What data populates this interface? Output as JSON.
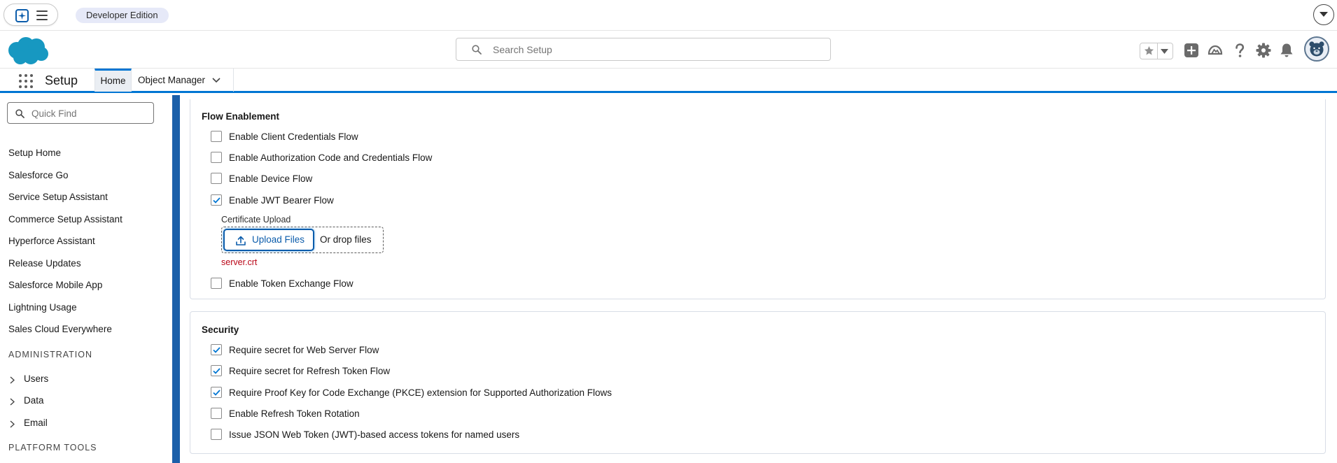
{
  "topbar": {
    "edition_badge": "Developer Edition",
    "icons": [
      "agentforce-icon",
      "menu-icon",
      "chevron-down-icon"
    ]
  },
  "header": {
    "search_placeholder": "Search Setup",
    "icons": [
      "salesforce-cloud-logo",
      "search-icon",
      "favorite-star-icon",
      "favorites-dropdown-icon",
      "global-actions-add-icon",
      "trailhead-icon",
      "help-icon",
      "setup-gear-icon",
      "notifications-bell-icon",
      "user-avatar"
    ]
  },
  "context_bar": {
    "app_title": "Setup",
    "tabs": [
      {
        "label": "Home",
        "active": true
      },
      {
        "label": "Object Manager",
        "active": false
      }
    ]
  },
  "sidebar": {
    "quick_find_placeholder": "Quick Find",
    "links": [
      "Setup Home",
      "Salesforce Go",
      "Service Setup Assistant",
      "Commerce Setup Assistant",
      "Hyperforce Assistant",
      "Release Updates",
      "Salesforce Mobile App",
      "Lightning Usage",
      "Sales Cloud Everywhere"
    ],
    "administration_heading": "ADMINISTRATION",
    "administration_items": [
      "Users",
      "Data",
      "Email"
    ],
    "platform_tools_heading": "PLATFORM TOOLS"
  },
  "flow_enablement": {
    "title": "Flow Enablement",
    "options": [
      {
        "label": "Enable Client Credentials Flow",
        "checked": false
      },
      {
        "label": "Enable Authorization Code and Credentials Flow",
        "checked": false
      },
      {
        "label": "Enable Device Flow",
        "checked": false
      },
      {
        "label": "Enable JWT Bearer Flow",
        "checked": true
      },
      {
        "label": "Enable Token Exchange Flow",
        "checked": false
      }
    ],
    "certificate_upload": {
      "label": "Certificate Upload",
      "button_label": "Upload Files",
      "drop_text": "Or drop files",
      "file_name": "server.crt"
    }
  },
  "security": {
    "title": "Security",
    "options": [
      {
        "label": "Require secret for Web Server Flow",
        "checked": true
      },
      {
        "label": "Require secret for Refresh Token Flow",
        "checked": true
      },
      {
        "label": "Require Proof Key for Code Exchange (PKCE) extension for Supported Authorization Flows",
        "checked": true
      },
      {
        "label": "Enable Refresh Token Rotation",
        "checked": false
      },
      {
        "label": "Issue JSON Web Token (JWT)-based access tokens for named users",
        "checked": false
      }
    ]
  },
  "colors": {
    "brand_blue": "#0176d3",
    "link_blue": "#0b5cab",
    "page_background": "#1b5fa9",
    "error_red": "#ba0517"
  }
}
